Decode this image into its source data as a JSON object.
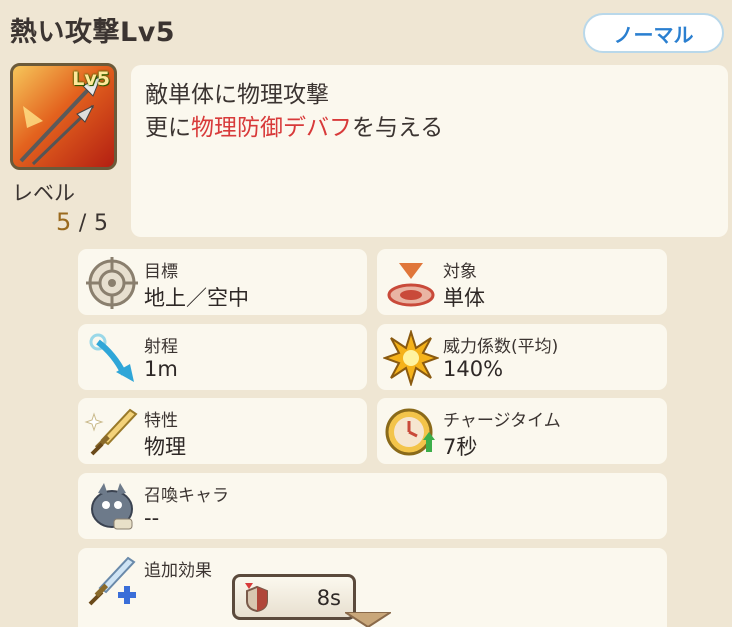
{
  "header": {
    "title": "熱い攻撃Lv5",
    "badge": "ノーマル"
  },
  "skill": {
    "icon_level_tag": "Lv5",
    "level_label": "レベル",
    "level_current": "5",
    "level_sep": "/",
    "level_max": "5"
  },
  "description": {
    "line1": "敵単体に物理攻撃",
    "line2_prefix": "更に",
    "line2_highlight": "物理防御デバフ",
    "line2_suffix": "を与える"
  },
  "stats": {
    "target": {
      "label": "目標",
      "value": "地上／空中"
    },
    "object": {
      "label": "対象",
      "value": "単体"
    },
    "range": {
      "label": "射程",
      "value": "1m"
    },
    "power": {
      "label": "威力係数(平均)",
      "value": "140%"
    },
    "trait": {
      "label": "特性",
      "value": "物理"
    },
    "charge": {
      "label": "チャージタイム",
      "value": "7秒"
    },
    "summon": {
      "label": "召喚キャラ",
      "value": "--"
    },
    "extra": {
      "label": "追加効果",
      "timer": "8s"
    }
  },
  "colors": {
    "highlight": "#d83a3a",
    "badge_text": "#2a7fd0",
    "level_current": "#9a6a1e"
  }
}
